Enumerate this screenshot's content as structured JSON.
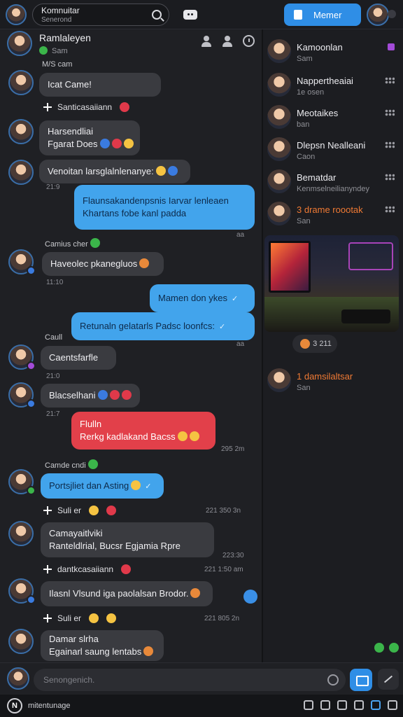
{
  "header": {
    "search_title": "Komnuitar",
    "search_sub": "Senerond",
    "member_btn": "Memer"
  },
  "chat_header": {
    "name": "Ramlaleyen",
    "sub": "Sam"
  },
  "messages": [
    {
      "label": "M/S cam",
      "text": "Icat Came!"
    },
    {
      "sys": "Santicasaiiann"
    },
    {
      "line1": "Harsendliai",
      "line2": "Fgarat Does"
    },
    {
      "text": "Venoitan larsglalnlenanye:",
      "time": "21:9"
    },
    {
      "line1": "Flaunsakandenpsnis  Iarvar lenleaen",
      "line2": "Khartans  fobe kanl padda",
      "time": "aa"
    },
    {
      "label": "Camius cher",
      "text": "Haveolec pkanegluos",
      "time": "11:10"
    },
    {
      "text": "Mamen don ykes"
    },
    {
      "text": "Retunaln gelatarls Padsc loonfcs:",
      "time": "aa"
    },
    {
      "label": "Caull",
      "text": "Caentsfarfle",
      "time": "21:0"
    },
    {
      "text": "Blacselhani",
      "time": "21:7"
    },
    {
      "line1": "Flulln",
      "line2": "Rerkg kadlakand Bacss",
      "time": "295 2m"
    },
    {
      "label": "Camde cndi",
      "text": "Portsjliet dan Asting"
    },
    {
      "sys": "Suli er",
      "time": "221 350 3n"
    },
    {
      "line1": "Camayaitlviki",
      "line2": "Ranteldlrial, Bucsr   Egjamia Rpre",
      "time": "223:30"
    },
    {
      "sys": "dantkcasaiiann",
      "time": "221 1:50 am"
    },
    {
      "text": "Ilasnl Vlsund iga paolalsan Brodor."
    },
    {
      "sys": "Suli er",
      "time": "221 805 2n"
    },
    {
      "line1": "Damar slrha",
      "line2": "Egainarl saung lentabs"
    }
  ],
  "members": [
    {
      "name": "Kamoonlan",
      "sub": "Sam"
    },
    {
      "name": "Nappertheaiai",
      "sub": "1e osen"
    },
    {
      "name": "Meotaikes",
      "sub": "ban"
    },
    {
      "name": "Dlepsn Nealleani",
      "sub": "Caon"
    },
    {
      "name": "Bematdar",
      "sub": "Kenmselneilianyndey"
    },
    {
      "name": "3 drame roootak",
      "sub": "San"
    },
    {
      "name": "1 damsilaltsar",
      "sub": "San"
    }
  ],
  "media_pill": "3 211",
  "composer": {
    "placeholder": "Senongenich."
  },
  "statusbar": {
    "logo": "N",
    "text": "mitentunage"
  },
  "colors": {
    "accent": "#2f8ee6",
    "bubble_out": "#42a4ec",
    "bubble_alert": "#e2404a",
    "online": "#3bb54a"
  }
}
